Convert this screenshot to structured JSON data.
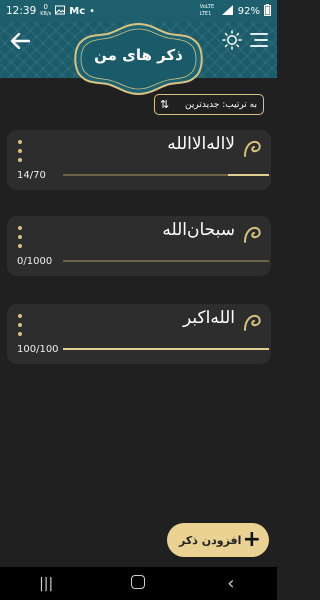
{
  "status_bar": {
    "time": "12:39",
    "data_speed": "0",
    "data_unit": "KB/s",
    "carrier_badge": "Mc",
    "extra": "•",
    "network": "VoLTE LTE1",
    "battery": "92%"
  },
  "header": {
    "title": "ذکر های من",
    "back_icon": "arrow-left-icon",
    "theme_icon": "sun-icon",
    "menu_icon": "hamburger-icon"
  },
  "sort": {
    "label": "به ترتیب: جدیدترین",
    "icon": "sort-arrows-icon"
  },
  "zikrs": [
    {
      "text": "لااله‌الاالله",
      "count": "14/70",
      "progress": 0.2
    },
    {
      "text": "سبحان‌الله",
      "count": "0/1000",
      "progress": 0.0
    },
    {
      "text": "الله‌اکبر",
      "count": "100/100",
      "progress": 1.0
    }
  ],
  "fab": {
    "label": "افزودن ذکر",
    "icon": "plus-icon"
  },
  "navbar": {
    "recents": "|||",
    "back": "‹"
  },
  "colors": {
    "background": "#202020",
    "card": "#2d2d2d",
    "header": "#1b5c6b",
    "gold": "#e4cf90",
    "accent_button": "#e9d292"
  }
}
